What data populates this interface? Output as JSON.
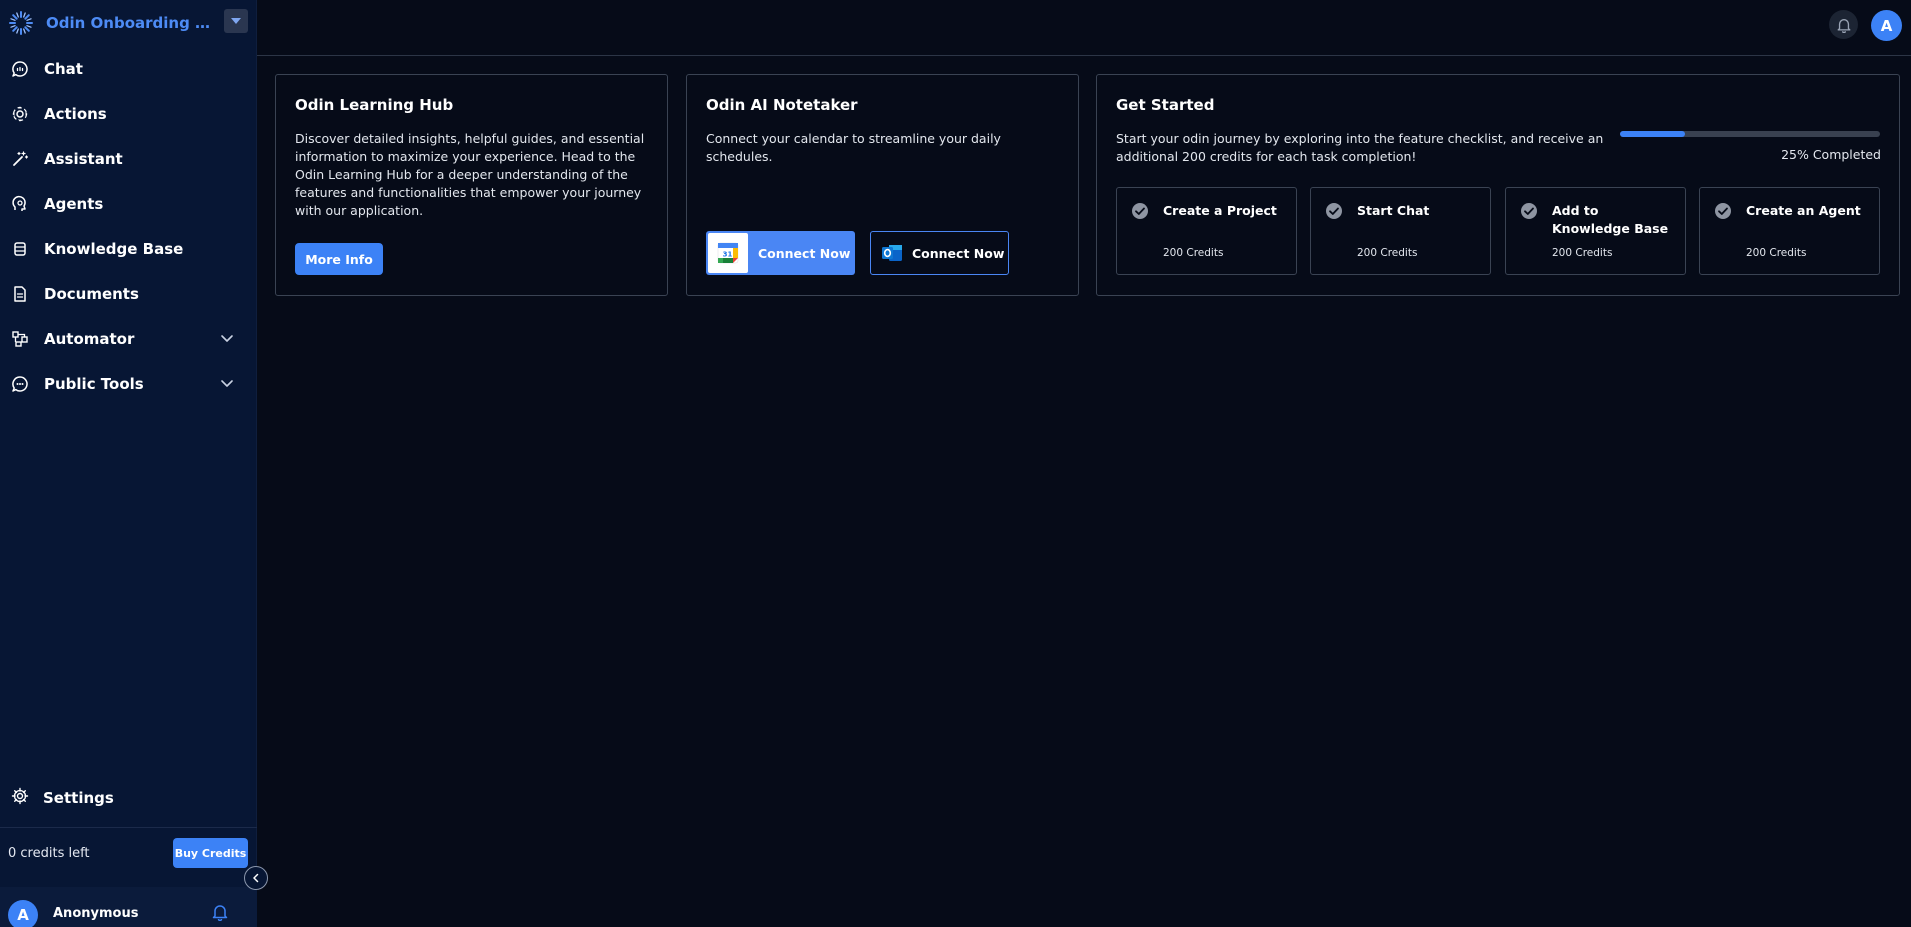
{
  "workspace": {
    "name": "Odin Onboarding Pr..."
  },
  "sidebar": {
    "items": [
      {
        "label": "Chat",
        "icon": "chat-icon"
      },
      {
        "label": "Actions",
        "icon": "actions-icon"
      },
      {
        "label": "Assistant",
        "icon": "wand-icon"
      },
      {
        "label": "Agents",
        "icon": "agent-icon"
      },
      {
        "label": "Knowledge Base",
        "icon": "database-icon"
      },
      {
        "label": "Documents",
        "icon": "document-icon"
      },
      {
        "label": "Automator",
        "icon": "automator-icon"
      },
      {
        "label": "Public Tools",
        "icon": "public-tools-icon"
      }
    ],
    "settings_label": "Settings",
    "credits_left": "0 credits left",
    "buy_credits_label": "Buy Credits",
    "user": {
      "initial": "A",
      "name": "Anonymous"
    }
  },
  "topbar": {
    "avatar_initial": "A"
  },
  "learning_hub": {
    "title": "Odin Learning Hub",
    "description": "Discover detailed insights, helpful guides, and essential information to maximize your experience. Head to the Odin Learning Hub for a deeper understanding of the features and functionalities that empower your journey with our application.",
    "button_label": "More Info"
  },
  "notetaker": {
    "title": "Odin AI Notetaker",
    "description": "Connect your calendar to streamline your daily schedules.",
    "google_button_label": "Connect Now",
    "outlook_button_label": "Connect Now"
  },
  "get_started": {
    "title": "Get Started",
    "description": "Start your odin journey by exploring into the feature checklist, and receive an additional 200 credits for each task completion!",
    "progress_fraction": 0.25,
    "progress_label": "25% Completed",
    "tasks": [
      {
        "title": "Create a Project",
        "credits": "200 Credits"
      },
      {
        "title": "Start Chat",
        "credits": "200 Credits"
      },
      {
        "title": "Add to Knowledge Base",
        "credits": "200 Credits"
      },
      {
        "title": "Create an Agent",
        "credits": "200 Credits"
      }
    ]
  },
  "colors": {
    "accent": "#3c82f6",
    "background": "#060b18",
    "sidebar": "#071634"
  }
}
